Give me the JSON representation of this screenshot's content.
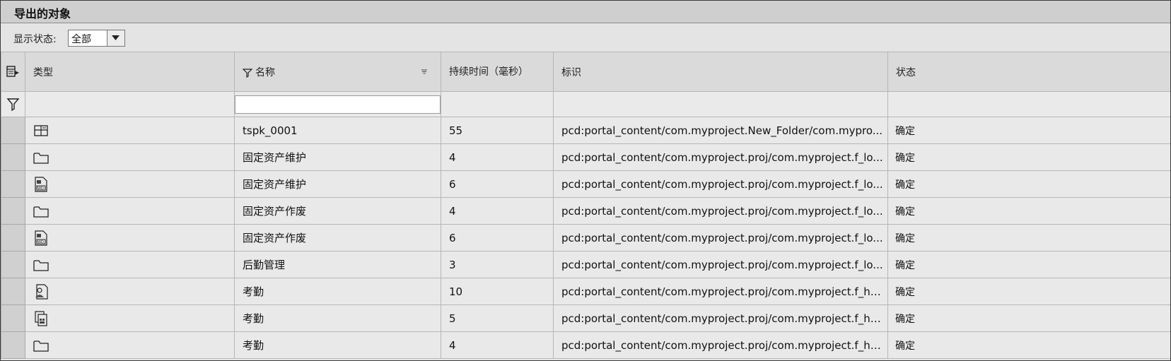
{
  "title": "导出的对象",
  "toolbar": {
    "status_label": "显示状态:",
    "status_value": "全部"
  },
  "columns": {
    "type": "类型",
    "name": "名称",
    "duration": "持续时间（毫秒）",
    "id": "标识",
    "state": "状态"
  },
  "rows": [
    {
      "icon": "iview-icon",
      "name": "tspk_0001",
      "duration": "55",
      "id": "pcd:portal_content/com.myproject.New_Folder/com.mypro...",
      "state": "确定"
    },
    {
      "icon": "folder-icon",
      "name": "固定资产维护",
      "duration": "4",
      "id": "pcd:portal_content/com.myproject.proj/com.myproject.f_lo...",
      "state": "确定"
    },
    {
      "icon": "webdynpro-icon",
      "name": "固定资产维护",
      "duration": "6",
      "id": "pcd:portal_content/com.myproject.proj/com.myproject.f_lo...",
      "state": "确定"
    },
    {
      "icon": "folder-icon",
      "name": "固定资产作废",
      "duration": "4",
      "id": "pcd:portal_content/com.myproject.proj/com.myproject.f_lo...",
      "state": "确定"
    },
    {
      "icon": "webdynpro-icon",
      "name": "固定资产作废",
      "duration": "6",
      "id": "pcd:portal_content/com.myproject.proj/com.myproject.f_lo...",
      "state": "确定"
    },
    {
      "icon": "folder-icon",
      "name": "后勤管理",
      "duration": "3",
      "id": "pcd:portal_content/com.myproject.proj/com.myproject.f_lo...",
      "state": "确定"
    },
    {
      "icon": "role-icon",
      "name": "考勤",
      "duration": "10",
      "id": "pcd:portal_content/com.myproject.proj/com.myproject.f_hr...",
      "state": "确定"
    },
    {
      "icon": "workset-icon",
      "name": "考勤",
      "duration": "5",
      "id": "pcd:portal_content/com.myproject.proj/com.myproject.f_hr...",
      "state": "确定"
    },
    {
      "icon": "folder-icon",
      "name": "考勤",
      "duration": "4",
      "id": "pcd:portal_content/com.myproject.proj/com.myproject.f_hr...",
      "state": "确定"
    }
  ]
}
